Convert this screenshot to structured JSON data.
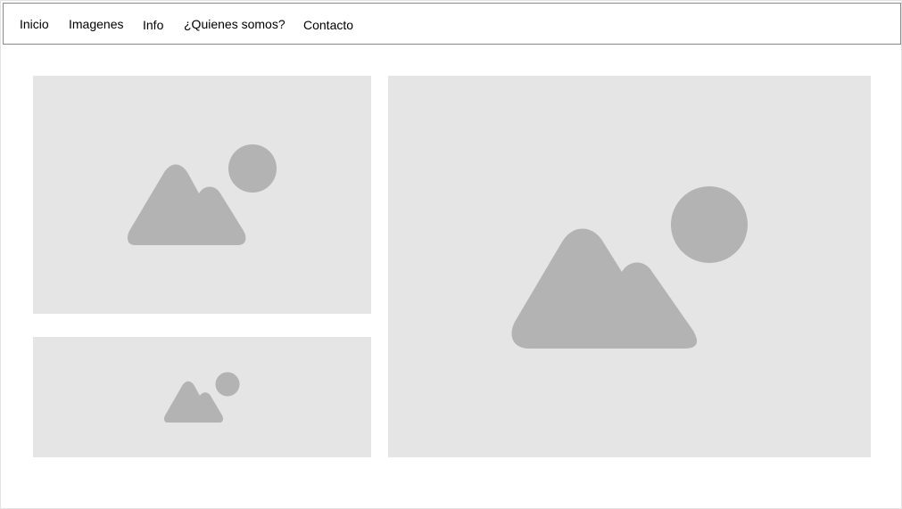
{
  "nav": {
    "items": [
      {
        "label": "Inicio"
      },
      {
        "label": "Imagenes"
      },
      {
        "label": "Info"
      },
      {
        "label": "¿Quienes somos?"
      },
      {
        "label": "Contacto"
      }
    ]
  },
  "content": {
    "images": [
      {
        "icon": "image-placeholder-icon"
      },
      {
        "icon": "image-placeholder-icon"
      },
      {
        "icon": "image-placeholder-icon"
      }
    ]
  },
  "colors": {
    "placeholder_bg": "#e5e5e5",
    "placeholder_icon": "#b3b3b3",
    "nav_border": "#8a8a8a"
  }
}
